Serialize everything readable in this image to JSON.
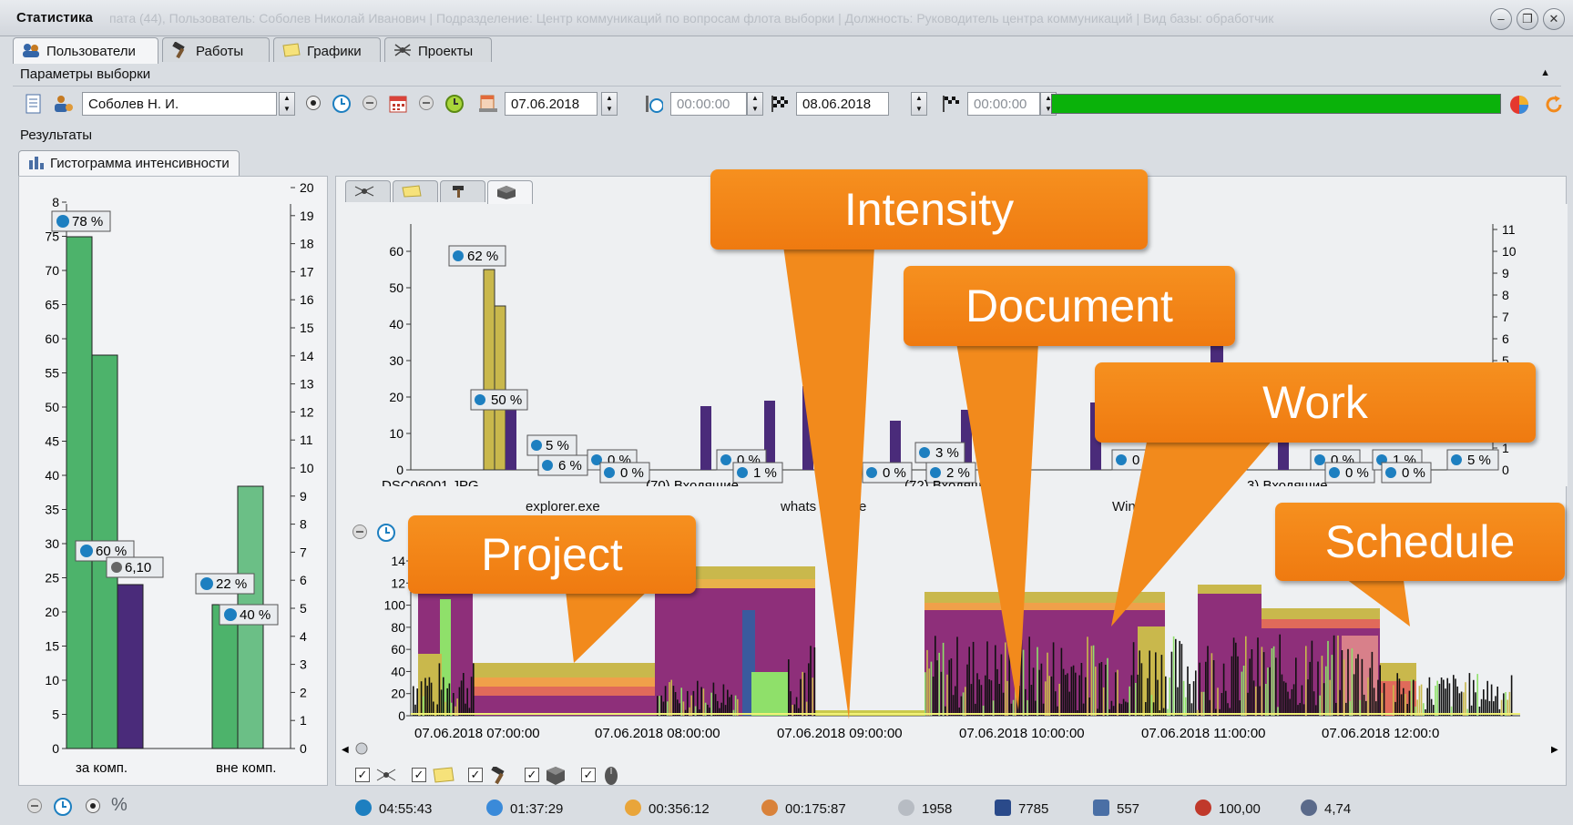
{
  "window": {
    "title": "Статистика",
    "faint_title": "пата (44), Пользователь: Соболев Николай Иванович | Подразделение: Центр коммуникаций по вопросам флота выборки | Должность: Руководитель центра коммуникаций | Вид базы: обработчик"
  },
  "tabs": [
    "Пользователи",
    "Работы",
    "Графики",
    "Проекты"
  ],
  "params": {
    "header": "Параметры выборки",
    "user": "Соболев Н.  И.",
    "date_from": "07.06.2018",
    "time_from": "00:00:00",
    "date_to": "08.06.2018",
    "time_to": "00:00:00"
  },
  "results": {
    "header": "Результаты",
    "tab": "Гистограмма интенсивности"
  },
  "left_chart": {
    "y_left": [
      "0",
      "5",
      "10",
      "15",
      "20",
      "25",
      "30",
      "35",
      "40",
      "45",
      "50",
      "55",
      "60",
      "65",
      "70",
      "75",
      "8"
    ],
    "y_right": [
      "0",
      "1",
      "2",
      "3",
      "4",
      "5",
      "6",
      "7",
      "8",
      "9",
      "10",
      "11",
      "12",
      "13",
      "14",
      "15",
      "16",
      "17",
      "18",
      "19",
      "20"
    ],
    "categories": [
      "за комп.",
      "вне комп."
    ],
    "labels": [
      "78 %",
      "60 %",
      "6,10",
      "22 %",
      "40 %"
    ]
  },
  "upper_chart": {
    "y_left": [
      "0",
      "10",
      "20",
      "30",
      "40",
      "50",
      "60"
    ],
    "y_right": [
      "0",
      "1",
      "2",
      "3",
      "4",
      "5",
      "6",
      "7",
      "8",
      "9",
      "10",
      "11"
    ],
    "x_labels_top": [
      "DSC06001.JPG",
      "(70) Входящие",
      "(72) Входящ",
      "3) Входящие"
    ],
    "x_labels_bottom": [
      "explorer.exe",
      "whats",
      "e",
      "Winw"
    ],
    "labels": [
      "62 %",
      "50 %",
      "5 %",
      "6 %",
      "0 %",
      "0 %",
      "0 %",
      "1 %",
      "0 %",
      "3 %",
      "2 %",
      "0 %",
      "0 %",
      "0 %",
      "1 %",
      "0 %",
      "5 %",
      "%"
    ]
  },
  "lower_chart": {
    "y": [
      "0",
      "20",
      "40",
      "60",
      "80",
      "100",
      "12",
      "14"
    ],
    "x": [
      "07.06.2018 07:00:00",
      "07.06.2018 08:00:00",
      "07.06.2018 09:00:00",
      "07.06.2018 10:00:00",
      "07.06.2018 11:00:00",
      "07.06.2018 12:00:0"
    ]
  },
  "left_footer": {
    "percent_symbol": "%"
  },
  "status": {
    "a": "04:55:43",
    "b": "01:37:29",
    "c": "00:356:12",
    "d": "00:175:87",
    "e": "1958",
    "f": "7785",
    "g": "557",
    "h": "100,00",
    "i": "4,74"
  },
  "callouts": {
    "intensity": "Intensity",
    "document": "Document",
    "work": "Work",
    "project": "Project",
    "schedule": "Schedule"
  },
  "colors": {
    "green": "#4db36b",
    "purple": "#4a2b7a",
    "olive": "#c9b84c",
    "magenta": "#8e2f7a",
    "orange": "#f28a1c",
    "progress": "#0ab20a"
  }
}
